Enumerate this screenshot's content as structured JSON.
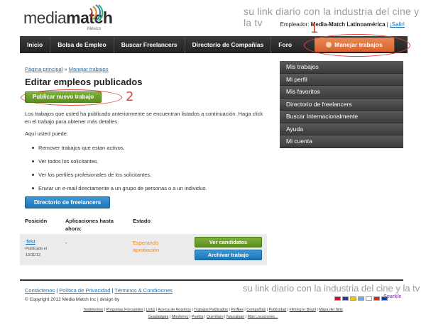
{
  "brand": {
    "logo_text_light": "media",
    "logo_text_bold": "match",
    "logo_sub": "México",
    "tagline": "su link diario con la industria del cine y la tv"
  },
  "employer": {
    "prefix": "Empleador:",
    "name": "Media-Match Latinoamérica",
    "separator": " | ",
    "logout": "¡Salir!"
  },
  "nav": {
    "items": [
      "Inicio",
      "Bolsa de Empleo",
      "Buscar Freelancers",
      "Directorio de Compañías",
      "Foro"
    ],
    "active": "Manejar trabajos"
  },
  "callouts": [
    "1",
    "2"
  ],
  "breadcrumb": {
    "home": "Página principal",
    "separator": " » ",
    "current": "Manejar trabajos"
  },
  "page_title": "Editar empleos publicados",
  "publish_button": "Publicar nuevo trabajo",
  "intro": "Los trabajos que usted ha publicado anteriormente se encuentran listados a continuación. Haga click en el trabajo para obtener más detalles.",
  "sub_heading": "Aquí usted puede:",
  "bullets": [
    "Remover trabajos que estan activos.",
    "Ver todos los solicitantes.",
    "Ver los perfiles profesionales de los solicitantes.",
    "Enviar un e-mail directamente a un grupo de personas o a un individuo."
  ],
  "freelancer_dir_button": "Directorio de freelancers",
  "table": {
    "headers": [
      "Posición",
      "Aplicaciones hasta ahora:",
      "Estado"
    ],
    "rows": [
      {
        "title": "Test",
        "date": "Publicado el 13/11/12",
        "applications": "-",
        "status": "Esperando aprobación",
        "btn_view": "Ver candidatos",
        "btn_archive": "Archivar trabajo"
      }
    ]
  },
  "side_menu": [
    "Mis trabajos",
    "Mi perfil",
    "Mis favoritos",
    "Directorio de freelancers",
    "Buscar Internacionalmente",
    "Ayuda",
    "Mi cuenta"
  ],
  "footer": {
    "links": [
      "Contáctenos",
      "Política de Privacidad",
      "Términos & Condiciones"
    ],
    "separator": " | ",
    "tagline": "su link diario con la industria del cine y la tv",
    "copyright": "© Copyright 2012 Media Match Inc | design by",
    "sparkle": "Sparkle",
    "sitemap_line1": [
      "Testimonios",
      "Preguntas Frecuentes",
      "Links",
      "Acerca de Nosotros",
      "Trabajos Publicados",
      "Perfiles",
      "Compañías",
      "Publicidad",
      "Filming in Brazil",
      "Mapa del Sitio"
    ],
    "sitemap_line2": [
      "Guadalajara",
      "Monterrey",
      "Puebla",
      "Querétaro",
      "Naucalpan",
      "Más Locaciones..."
    ],
    "flag_colors": [
      "#c8102e",
      "#1f3a93",
      "#f4c300",
      "#6cace4",
      "#ffffff",
      "#d52b1e",
      "#0039a6",
      "#e8b000"
    ]
  },
  "colors": {
    "accent_orange": "#d8612e",
    "callout_red": "#e0473c",
    "status_orange": "#f08b24",
    "link_blue": "#1f6fae",
    "green_button": "#6a9f2a",
    "blue_button": "#2784c5"
  }
}
